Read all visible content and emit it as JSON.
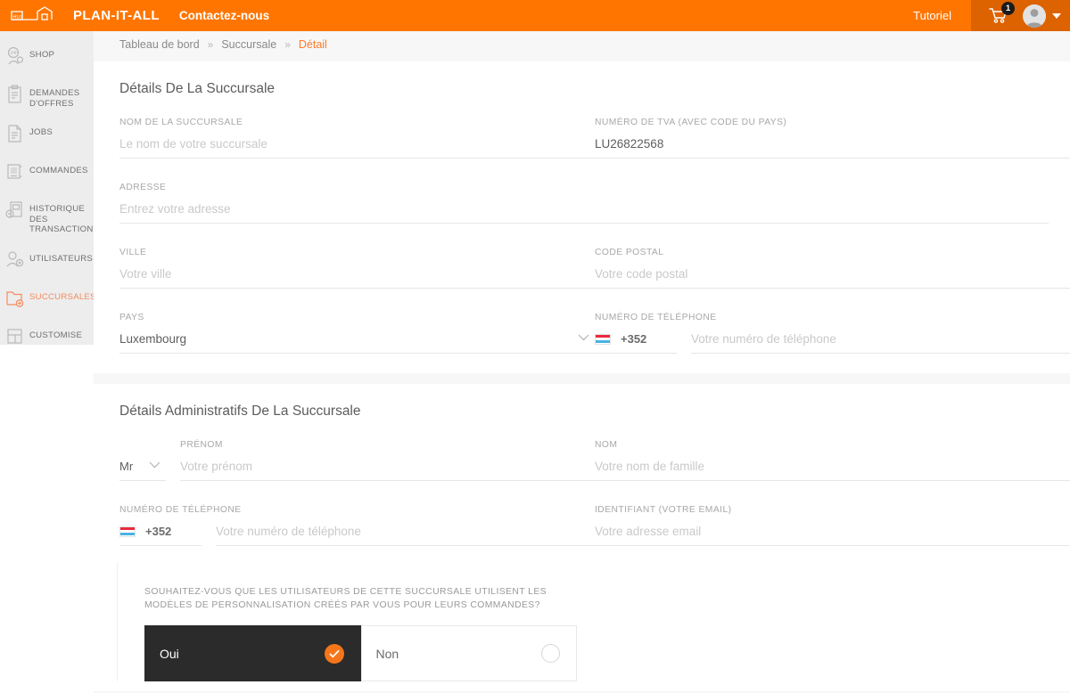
{
  "header": {
    "logo_icon": "house-bank-logo-icon",
    "brand": "PLAN-IT-ALL",
    "contact_link": "Contactez-nous",
    "tutorial_link": "Tutoriel",
    "cart_icon": "shopping-cart-icon",
    "cart_count": "1",
    "avatar_icon": "user-avatar-icon",
    "caret_icon": "chevron-down-icon",
    "bg_color": "#ff7500",
    "bg_dark_color": "#dd6200"
  },
  "sidebar": {
    "items": [
      {
        "label": "SHOP",
        "icon": "shop-24h-icon",
        "active": false
      },
      {
        "label": "DEMANDES\nD'OFFRES",
        "icon": "clipboard-offers-icon",
        "active": false
      },
      {
        "label": "JOBS",
        "icon": "document-jobs-icon",
        "active": false
      },
      {
        "label": "COMMANDES",
        "icon": "orders-monitor-icon",
        "active": false
      },
      {
        "label": "HISTORIQUE DES\nTRANSACTIONS",
        "icon": "transaction-history-icon",
        "active": false
      },
      {
        "label": "UTILISATEURS",
        "icon": "users-icon",
        "active": false
      },
      {
        "label": "SUCCURSALES",
        "icon": "branch-folder-add-icon",
        "active": true
      },
      {
        "label": "CUSTOMISE",
        "icon": "customise-template-icon",
        "active": false
      }
    ],
    "active_color": "#f58a5b"
  },
  "breadcrumb": {
    "items": [
      "Tableau de bord",
      "Succursale"
    ],
    "separator": "»",
    "current": "Détail"
  },
  "branch_details": {
    "title": "Détails De La Succursale",
    "branch_name": {
      "label": "NOM DE LA SUCCURSALE",
      "placeholder": "Le nom de votre succursale",
      "value": ""
    },
    "vat_number": {
      "label": "NUMÉRO DE TVA (AVEC CODE DU PAYS)",
      "placeholder": "",
      "value": "LU26822568"
    },
    "address": {
      "label": "ADRESSE",
      "placeholder": "Entrez votre adresse",
      "value": ""
    },
    "city": {
      "label": "VILLE",
      "placeholder": "Votre ville",
      "value": ""
    },
    "postal_code": {
      "label": "CODE POSTAL",
      "placeholder": "Votre code postal",
      "value": ""
    },
    "country": {
      "label": "PAYS",
      "value": "Luxembourg",
      "chevron_icon": "chevron-down-icon"
    },
    "phone": {
      "label": "NUMÉRO DE TÉLÉPHONE",
      "flag_icon": "luxembourg-flag-icon",
      "country_code": "+352",
      "placeholder": "Votre numéro de téléphone",
      "value": ""
    }
  },
  "admin_details": {
    "title": "Détails Administratifs De La Succursale",
    "title_select": {
      "value": "Mr",
      "chevron_icon": "chevron-down-icon"
    },
    "first_name": {
      "label": "PRÉNOM",
      "placeholder": "Votre prénom",
      "value": ""
    },
    "last_name": {
      "label": "NOM",
      "placeholder": "Votre nom de famille",
      "value": ""
    },
    "phone": {
      "label": "NUMÉRO DE TÉLÉPHONE",
      "flag_icon": "luxembourg-flag-icon",
      "country_code": "+352",
      "placeholder": "Votre numéro de téléphone",
      "value": ""
    },
    "email": {
      "label": "IDENTIFIANT (VOTRE EMAIL)",
      "placeholder": "Votre adresse email",
      "value": ""
    },
    "question": {
      "text": "SOUHAITEZ-VOUS QUE LES UTILISATEURS DE CETTE SUCCURSALE UTILISENT LES MODÈLES DE PERSONNALISATION CRÉÉS PAR VOUS POUR LEURS COMMANDES?",
      "options": [
        {
          "label": "Oui",
          "selected": true
        },
        {
          "label": "Non",
          "selected": false
        }
      ],
      "selected_bg": "#2b2b2b",
      "check_color": "#f5761a"
    }
  }
}
